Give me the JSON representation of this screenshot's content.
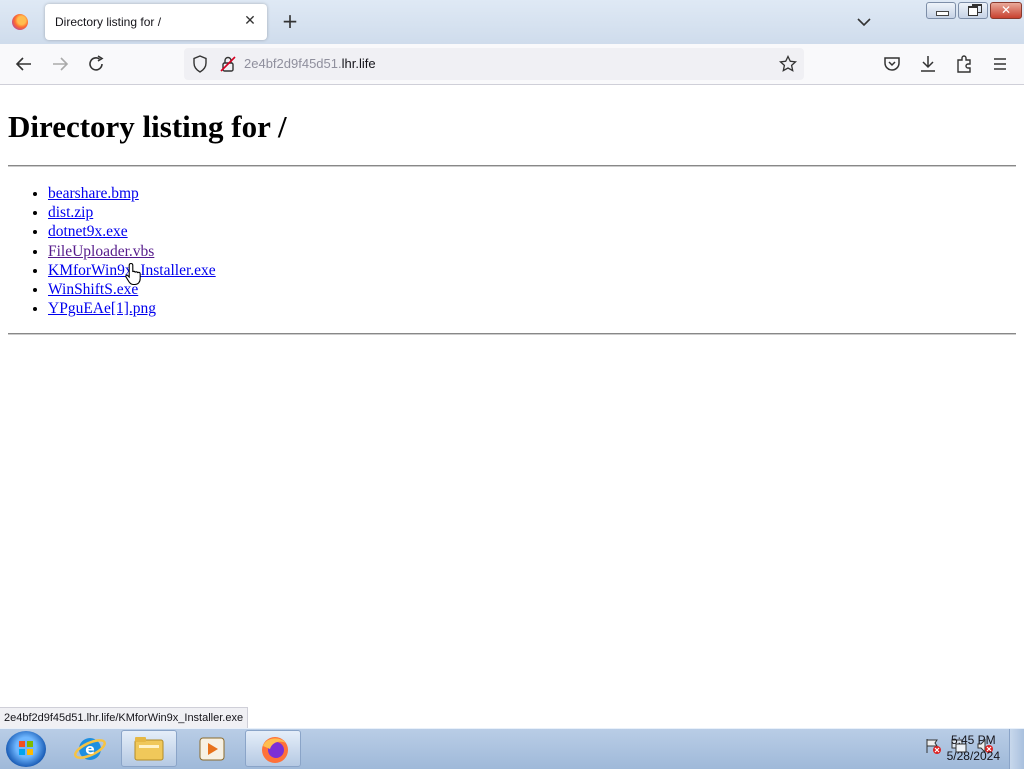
{
  "browser": {
    "tab": {
      "title": "Directory listing for /"
    },
    "url": {
      "host_prefix": "2e4bf2d9f45d51.",
      "host_main": "lhr.life"
    }
  },
  "page": {
    "heading": "Directory listing for /",
    "files": [
      {
        "name": "bearshare.bmp",
        "visited": false
      },
      {
        "name": "dist.zip",
        "visited": false
      },
      {
        "name": "dotnet9x.exe",
        "visited": false
      },
      {
        "name": "FileUploader.vbs",
        "visited": true
      },
      {
        "name": "KMforWin9x_Installer.exe",
        "visited": false
      },
      {
        "name": "WinShiftS.exe",
        "visited": false
      },
      {
        "name": "YPguEAe[1].png",
        "visited": false
      }
    ],
    "status_link": "2e4bf2d9f45d51.lhr.life/KMforWin9x_Installer.exe"
  },
  "taskbar": {
    "time": "5:45 PM",
    "date": "5/28/2024",
    "apps": [
      "internet-explorer-icon",
      "file-explorer-icon",
      "media-player-icon",
      "firefox-icon"
    ]
  },
  "colors": {
    "link": "#0000ee",
    "link_visited": "#551a8b",
    "taskbar": "#a9c0de"
  }
}
